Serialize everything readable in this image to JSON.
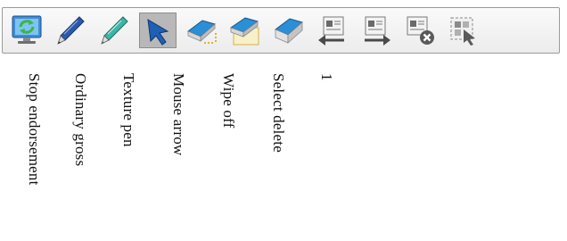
{
  "toolbar": {
    "tools": [
      {
        "icon": "refresh-monitor-icon",
        "label": "Stop endorsement"
      },
      {
        "icon": "ordinary-pen-icon",
        "label": "Ordinary gross"
      },
      {
        "icon": "texture-pen-icon",
        "label": "Texture pen"
      },
      {
        "icon": "mouse-arrow-icon",
        "label": "Mouse arrow",
        "active": true
      },
      {
        "icon": "wipe-off-eraser-icon",
        "label": "Wipe off"
      },
      {
        "icon": "select-delete-eraser-icon",
        "label": "Select delete"
      },
      {
        "icon": "clear-eraser-icon",
        "label": "1"
      },
      {
        "icon": "previous-page-icon"
      },
      {
        "icon": "next-page-icon"
      },
      {
        "icon": "close-page-icon"
      },
      {
        "icon": "screenshot-capture-icon"
      }
    ]
  },
  "colors": {
    "toolbar_border": "#9a9a9a",
    "active_bg": "#b8b8b8",
    "eraser_blue": "#2a8fd6",
    "pen_blue": "#2b5aa8",
    "pen_teal": "#3fb5a6",
    "arrow_blue": "#1f5fb4"
  }
}
